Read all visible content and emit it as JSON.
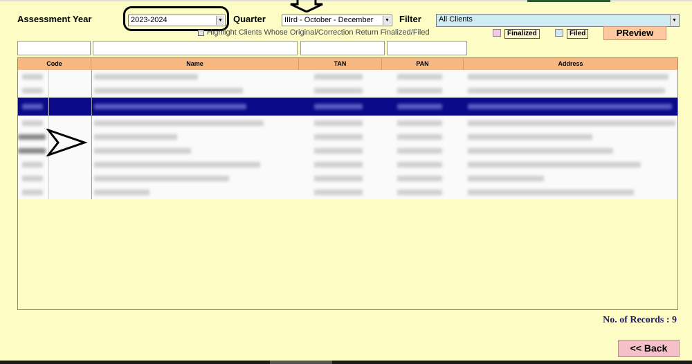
{
  "filters": {
    "assessment_year_label": "Assessment Year",
    "assessment_year_value": "2023-2024",
    "quarter_label": "Quarter",
    "quarter_value": "IIIrd - October - December",
    "filter_label": "Filter",
    "filter_value": "All Clients"
  },
  "highlight_checkbox_label": "Highlight Clients Whose Original/Correction Return Finalized/Filed",
  "legend": {
    "finalized": "Finalized",
    "filed": "Filed",
    "finalized_color": "#f3c6ec",
    "filed_color": "#cfe6f6"
  },
  "preview_button": "PReview",
  "table": {
    "columns": [
      "Code",
      "Name",
      "TAN",
      "PAN",
      "Address"
    ],
    "selected_row_color": "#0a0a8a",
    "header_color": "#f6b782"
  },
  "records_label": "No. of Records : 9",
  "back_button": "<< Back",
  "icons": {
    "down_arrow": "arrow-down-outline-icon",
    "right_arrow": "arrow-right-outline-icon"
  }
}
